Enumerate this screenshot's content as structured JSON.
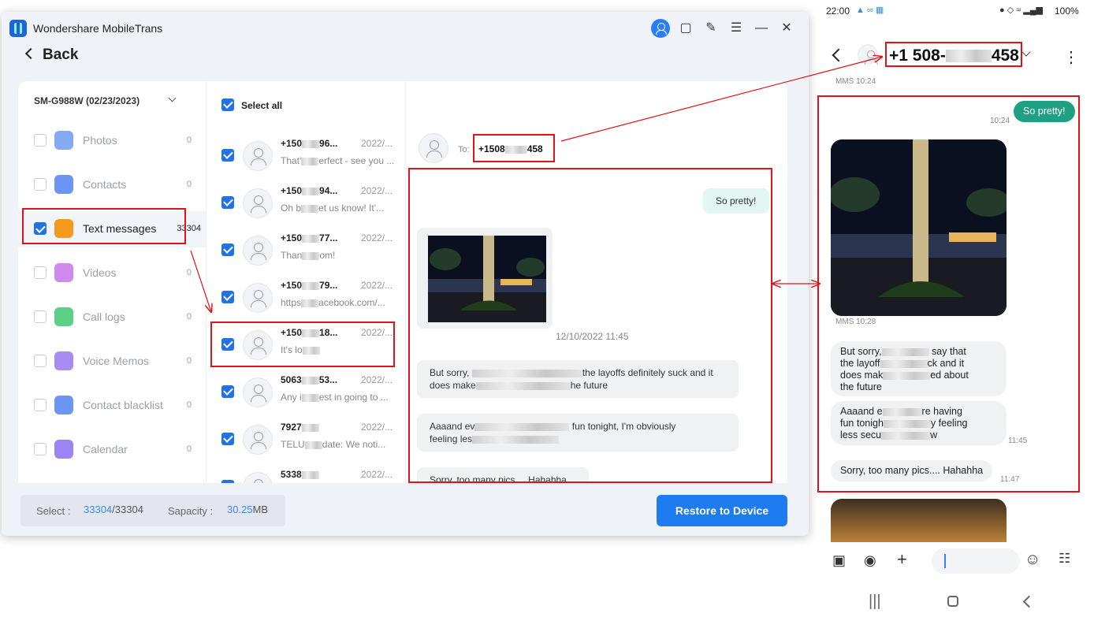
{
  "app": {
    "title": "Wondershare MobileTrans",
    "back_label": "Back"
  },
  "device": {
    "name": "SM-G988W (02/23/2023)"
  },
  "categories": [
    {
      "label": "Photos",
      "count": "0",
      "icon": "photos-icon",
      "color": "#5b8def",
      "selected": false
    },
    {
      "label": "Contacts",
      "count": "0",
      "icon": "contacts-icon",
      "color": "#3a73f0",
      "selected": false
    },
    {
      "label": "Text messages",
      "count": "33304",
      "icon": "messages-icon",
      "color": "#f39a1e",
      "selected": true
    },
    {
      "label": "Videos",
      "count": "0",
      "icon": "videos-icon",
      "color": "#c061e8",
      "selected": false
    },
    {
      "label": "Call logs",
      "count": "0",
      "icon": "call-logs-icon",
      "color": "#26c05c",
      "selected": false
    },
    {
      "label": "Voice Memos",
      "count": "0",
      "icon": "voice-memo-icon",
      "color": "#8a66ee",
      "selected": false
    },
    {
      "label": "Contact blacklist",
      "count": "0",
      "icon": "blacklist-icon",
      "color": "#3a73f0",
      "selected": false
    },
    {
      "label": "Calendar",
      "count": "0",
      "icon": "calendar-icon",
      "color": "#7a5cf0",
      "selected": false
    }
  ],
  "list": {
    "select_all": "Select all",
    "threads": [
      {
        "name_a": "+150",
        "name_b": "96...",
        "date": "2022/...",
        "prev_a": "That'",
        "prev_b": "erfect - see you ..."
      },
      {
        "name_a": "+150",
        "name_b": "94...",
        "date": "2022/...",
        "prev_a": "Oh b",
        "prev_b": "et us know! It'..."
      },
      {
        "name_a": "+150",
        "name_b": "77...",
        "date": "2022/...",
        "prev_a": "Than",
        "prev_b": "om!"
      },
      {
        "name_a": "+150",
        "name_b": "79...",
        "date": "2022/...",
        "prev_a": "https",
        "prev_b": "acebook.com/..."
      },
      {
        "name_a": "+150",
        "name_b": "18...",
        "date": "2022/...",
        "prev_a": "It's lo",
        "prev_b": ""
      },
      {
        "name_a": "5063",
        "name_b": "53...",
        "date": "2022/...",
        "prev_a": "Any i",
        "prev_b": "est in going to ..."
      },
      {
        "name_a": "7927",
        "name_b": "",
        "date": "2022/...",
        "prev_a": "TELU",
        "prev_b": "date: We noti..."
      },
      {
        "name_a": "5338",
        "name_b": "",
        "date": "2022/...",
        "prev_a": "",
        "prev_b": ""
      }
    ]
  },
  "chat": {
    "to_label": "To:",
    "to_number_a": "+1508",
    "to_number_b": "458",
    "out_msg": "So pretty!",
    "timestamp": "12/10/2022 11:45",
    "msg1_a": "But sorry,",
    "msg1_b": "the layoffs definitely suck and it",
    "msg1_c": "does make",
    "msg1_d": "he future",
    "msg2_a": "Aaaand ev",
    "msg2_b": "fun tonight, I'm obviously",
    "msg2_c": "feeling les",
    "msg3": "Sorry, too many pics.... Hahahha"
  },
  "footer": {
    "select_label": "Select :",
    "selected": "33304",
    "total": "/33304",
    "capacity_label": "Sapacity :",
    "capacity_value": "30.25",
    "capacity_unit": "MB",
    "restore_label": "Restore to Device"
  },
  "phone": {
    "time": "22:00",
    "battery": "100%",
    "number_a": "+1 508-",
    "number_b": "458",
    "mms_top": "MMS 10:24",
    "out_msg": "So pretty!",
    "out_time": "10:24",
    "photo_time": "MMS 10:28",
    "m1_a": "But sorry,",
    "m1_b": "say that",
    "m1_c": "the layoff",
    "m1_d": "ck and it",
    "m1_e": "does mak",
    "m1_f": "ed about",
    "m1_g": "the future",
    "m2_a": "Aaaand e",
    "m2_b": "re having",
    "m2_c": "fun tonigh",
    "m2_d": "y feeling",
    "m2_e": "less secu",
    "m2_f": "w",
    "m2_time": "11:45",
    "m3": "Sorry, too many pics.... Hahahha",
    "m3_time": "11:47"
  },
  "colors": {
    "accent": "#1f7bf2",
    "annotation": "#e0121a",
    "phone_bubble": "#1fa083"
  }
}
